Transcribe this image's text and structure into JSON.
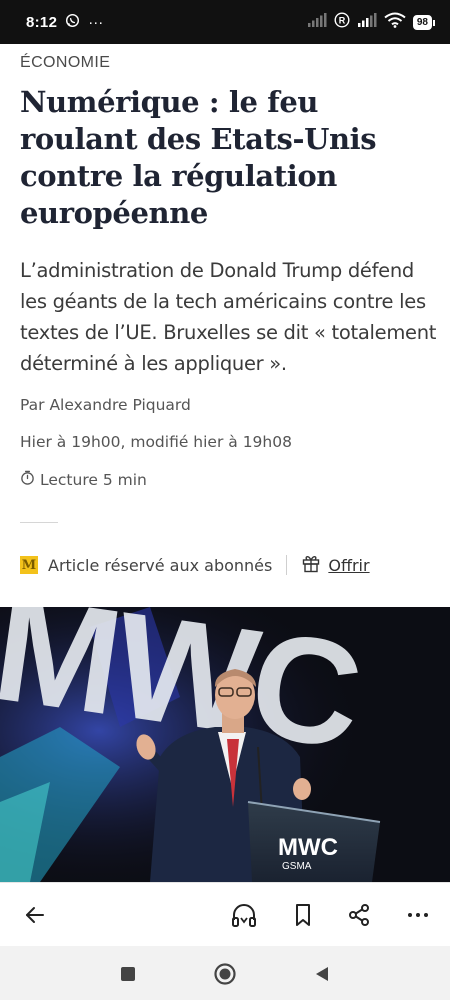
{
  "status_bar": {
    "time": "8:12",
    "dots": "···",
    "battery": "98",
    "icons": [
      "whatsapp-icon",
      "signal-icon",
      "roaming-icon",
      "signal-icon",
      "wifi-icon",
      "battery-icon"
    ]
  },
  "article": {
    "section": "ÉCONOMIE",
    "headline": "Numérique : le feu roulant des Etats-Unis contre la régulation européenne",
    "standfirst": "L’administration de Donald Trump défend les géants de la tech américains contre les textes de l’UE. Bruxelles se dit « totalement déterminé à les appliquer ».",
    "author": "Par Alexandre Piquard",
    "dates": "Hier à 19h00, modifié hier à 19h08",
    "read_time": "Lecture 5 min"
  },
  "subscriber": {
    "badge": "M",
    "label": "Article réservé aux abonnés",
    "offer_label": "Offrir"
  },
  "photo": {
    "backdrop_text": "MWC",
    "podium_logo": "MWC",
    "podium_sub": "GSMA"
  },
  "toolbar": {
    "icons": [
      "back-arrow-icon",
      "headphones-icon",
      "bookmark-icon",
      "share-icon",
      "more-icon"
    ]
  },
  "navbar": {
    "icons": [
      "recents-icon",
      "home-icon",
      "back-icon"
    ]
  },
  "colors": {
    "headline": "#1f2433",
    "badge": "#f3c21b",
    "status_bar": "#111111"
  }
}
